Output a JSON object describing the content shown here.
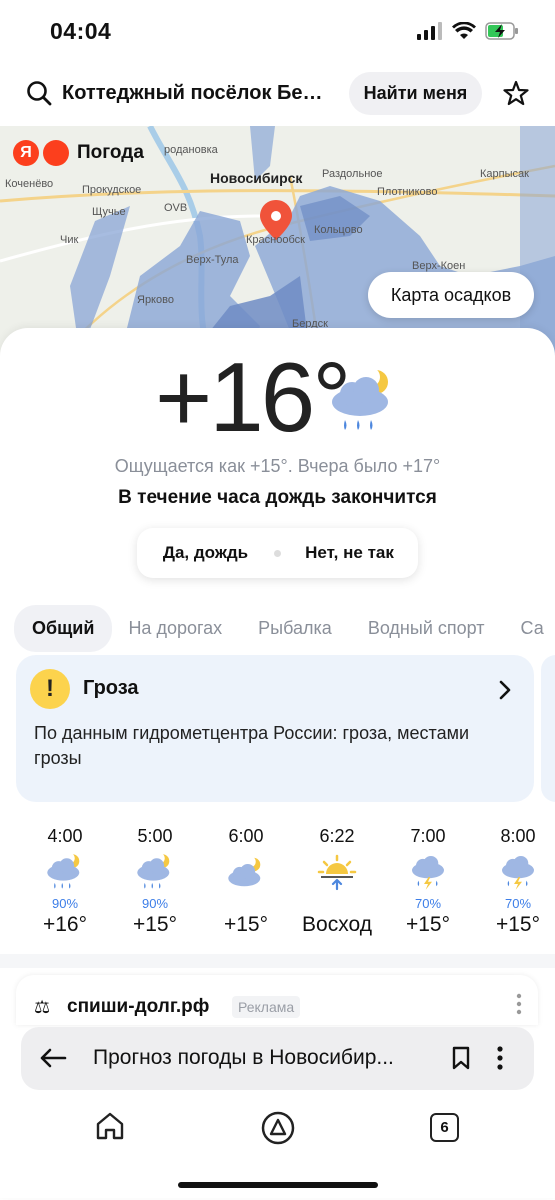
{
  "status_bar": {
    "time": "04:04"
  },
  "search": {
    "query": "Коттеджный посёлок Белы...",
    "find_me_label": "Найти меня"
  },
  "map": {
    "brand": "Погода",
    "brand_letter": "Я",
    "cities": {
      "novosibirsk": "Новосибирск",
      "kochenevo": "Коченёво",
      "prokudskoe": "Прокудское",
      "razdolnoe": "Раздольное",
      "plotnikovo": "Плотниково",
      "karpysak": "Карпысак",
      "krasnoobsk": "Краснообск",
      "koltsovo": "Кольцово",
      "verkh_tula": "Верх-Тула",
      "yarkovo": "Ярково",
      "chik": "Чик",
      "shchuchye": "Щучье",
      "ovb": "OVB",
      "verkh_kolyvan": "Верх-Коен",
      "berdsk": "Бердск",
      "rodanovka": "родановка"
    },
    "precip_button": "Карта осадков",
    "colors": {
      "rain": "#8aa6d6",
      "rain_dark": "#6e8cc4"
    }
  },
  "current": {
    "temperature": "+16°",
    "feels_like": "Ощущается как +15°. Вчера было +17°",
    "nowcast": "В течение часа дождь закончится",
    "feedback_yes": "Да, дождь",
    "feedback_no": "Нет, не так"
  },
  "tabs": [
    "Общий",
    "На дорогах",
    "Рыбалка",
    "Водный спорт",
    "Са"
  ],
  "alert": {
    "title": "Гроза",
    "text": "По данным гидрометцентра России: гроза, местами грозы",
    "icon": "exclamation-icon",
    "color": "#fcd34d"
  },
  "hourly": [
    {
      "time": "4:00",
      "icon": "night-rain-icon",
      "prob": "90%",
      "temp": "+16°"
    },
    {
      "time": "5:00",
      "icon": "night-rain-icon",
      "prob": "90%",
      "temp": "+15°"
    },
    {
      "time": "6:00",
      "icon": "night-cloudy-icon",
      "prob": "",
      "temp": "+15°"
    },
    {
      "time": "6:22",
      "icon": "sunrise-icon",
      "prob": "",
      "temp": "Восход"
    },
    {
      "time": "7:00",
      "icon": "thunderstorm-icon",
      "prob": "70%",
      "temp": "+15°"
    },
    {
      "time": "8:00",
      "icon": "thunderstorm-icon",
      "prob": "70%",
      "temp": "+15°"
    }
  ],
  "ad": {
    "title": "спиши-долг.рф",
    "badge": "Реклама"
  },
  "browser": {
    "url": "Прогноз погоды в Новосибир...",
    "tab_count": "6"
  }
}
